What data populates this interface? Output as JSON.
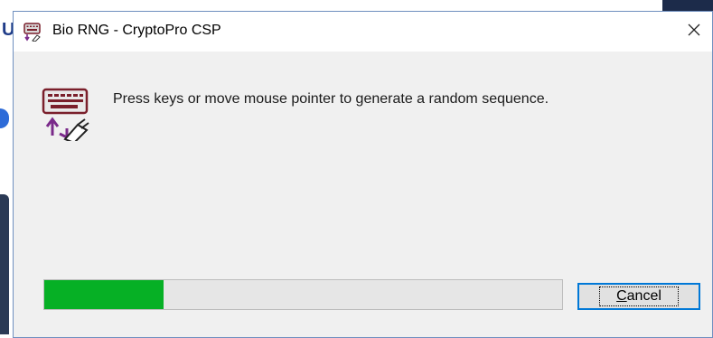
{
  "background": {
    "partial_letter": "U"
  },
  "window": {
    "title": "Bio RNG - CryptoPro CSP",
    "close_glyph": "✕",
    "icon": "keyboard-mouse-icon"
  },
  "content": {
    "icon": "keyboard-mouse-icon",
    "message": "Press keys or move mouse pointer to generate a random sequence."
  },
  "progress": {
    "value_percent": 23,
    "fill_color": "#06b025"
  },
  "buttons": {
    "cancel_label": "Cancel"
  }
}
